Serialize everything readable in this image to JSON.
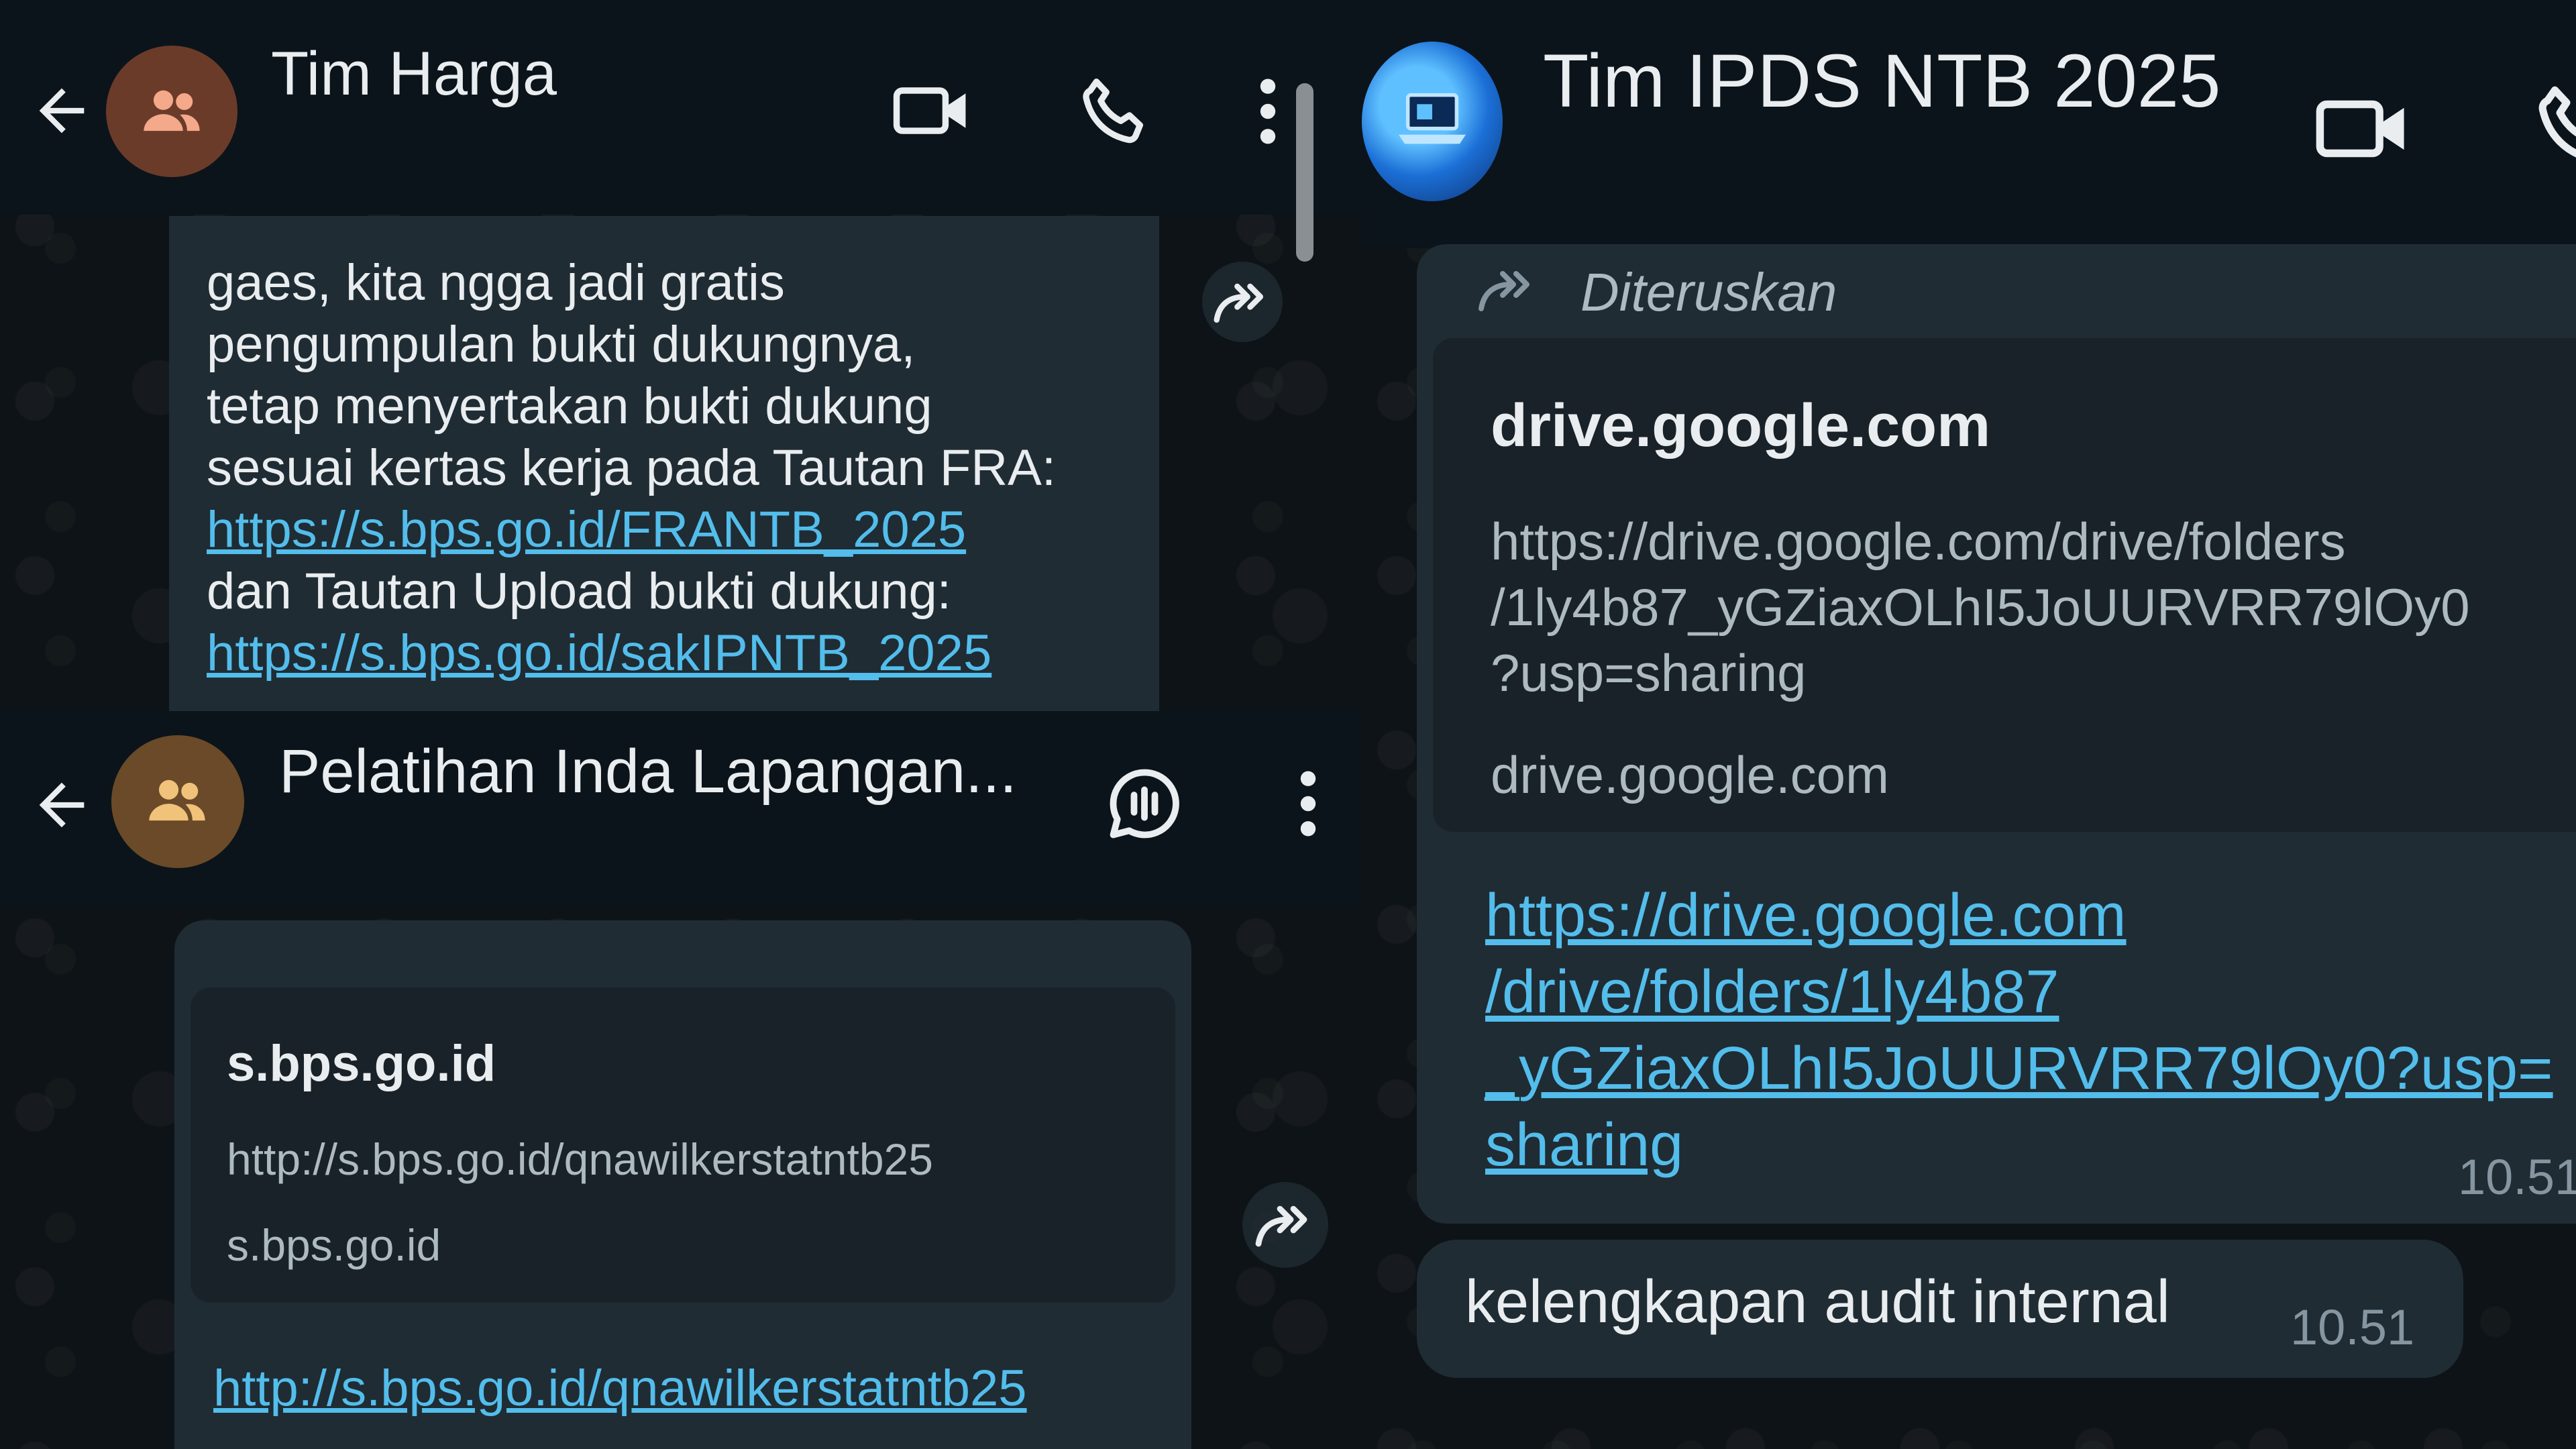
{
  "left_top": {
    "header": {
      "title": "Tim Harga"
    },
    "message": {
      "lines": [
        "gaes, kita ngga jadi gratis",
        "pengumpulan bukti dukungnya,",
        "tetap menyertakan bukti dukung",
        "sesuai kertas kerja pada Tautan FRA:"
      ],
      "link1": "https://s.bps.go.id/FRANTB_2025",
      "line5": "dan Tautan Upload bukti dukung:",
      "link2": "https://s.bps.go.id/sakIPNTB_2025"
    }
  },
  "left_bottom": {
    "header": {
      "title": "Pelatihan Inda Lapangan..."
    },
    "message": {
      "preview_domain": "s.bps.go.id",
      "preview_url": "http://s.bps.go.id/qnawilkerstatntb25",
      "preview_site": "s.bps.go.id",
      "link": "http://s.bps.go.id/qnawilkerstatntb25"
    }
  },
  "right": {
    "header": {
      "title": "Tim IPDS NTB 2025"
    },
    "forwarded_label": "Diteruskan",
    "message": {
      "preview_domain": "drive.google.com",
      "preview_url_lines": [
        "https://drive.google.com/drive/folders",
        "/1ly4b87_yGZiaxOLhI5JoUURVRR79lOy0",
        "?usp=sharing"
      ],
      "preview_site": "drive.google.com",
      "link_lines": [
        "https://drive.google.com",
        "/drive/folders/1ly4b87",
        "_yGZiaxOLhI5JoUURVRR79lOy0?usp=",
        "sharing"
      ],
      "time": "10.51"
    },
    "message2": {
      "text": "kelengkapan audit internal",
      "time": "10.51"
    }
  },
  "colors": {
    "header_bg": "#0b141a",
    "bubble_bg": "#1f2c34",
    "preview_bg": "#182228",
    "link": "#53bdeb",
    "group_avatar_orange": "#6b3b2a",
    "group_avatar_gold": "#6a4a28"
  },
  "icons": [
    "back-arrow-icon",
    "group-icon",
    "video-call-icon",
    "voice-call-icon",
    "more-options-icon",
    "forward-icon",
    "voice-chat-icon",
    "forwarded-icon"
  ]
}
